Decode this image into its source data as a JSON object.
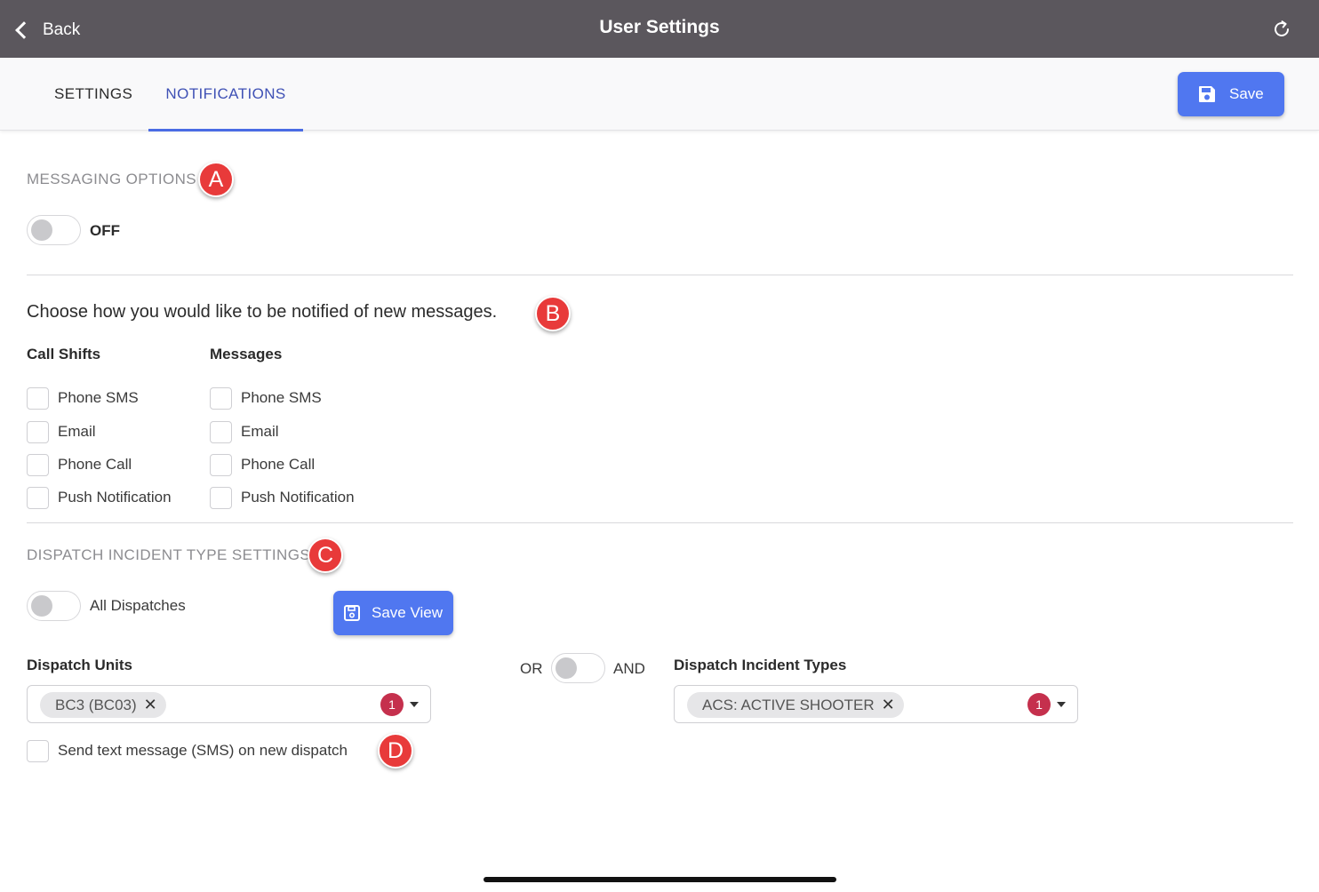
{
  "header": {
    "back_label": "Back",
    "title": "User Settings",
    "refresh_icon": "refresh-icon"
  },
  "tabs": [
    {
      "label": "SETTINGS",
      "active": false
    },
    {
      "label": "NOTIFICATIONS",
      "active": true
    }
  ],
  "save_button": {
    "label": "Save",
    "icon": "save-icon"
  },
  "colors": {
    "header_bg": "#5b575d",
    "accent": "#5077f0",
    "tab_active": "#3f51b5",
    "marker": "#e83a3a",
    "badge": "#c5304d"
  },
  "messaging": {
    "heading": "MESSAGING OPTIONS",
    "marker": "A",
    "toggle_label": "OFF",
    "toggle_on": false
  },
  "notify": {
    "prompt": "Choose how you would like to be notified of new messages.",
    "marker": "B",
    "columns": [
      {
        "title": "Call Shifts",
        "options": [
          "Phone SMS",
          "Email",
          "Phone Call",
          "Push Notification"
        ]
      },
      {
        "title": "Messages",
        "options": [
          "Phone SMS",
          "Email",
          "Phone Call",
          "Push Notification"
        ]
      }
    ]
  },
  "dispatch": {
    "heading": "DISPATCH INCIDENT TYPE SETTINGS",
    "marker": "C",
    "all_label": "All Dispatches",
    "all_on": false,
    "save_view_label": "Save View",
    "units_label": "Dispatch Units",
    "units_chip": "BC3 (BC03)",
    "units_count": "1",
    "or_label": "OR",
    "and_label": "AND",
    "types_label": "Dispatch Incident Types",
    "types_chip": "ACS: ACTIVE SHOOTER",
    "types_count": "1",
    "sms_label": "Send text message (SMS) on new dispatch",
    "sms_marker": "D"
  }
}
